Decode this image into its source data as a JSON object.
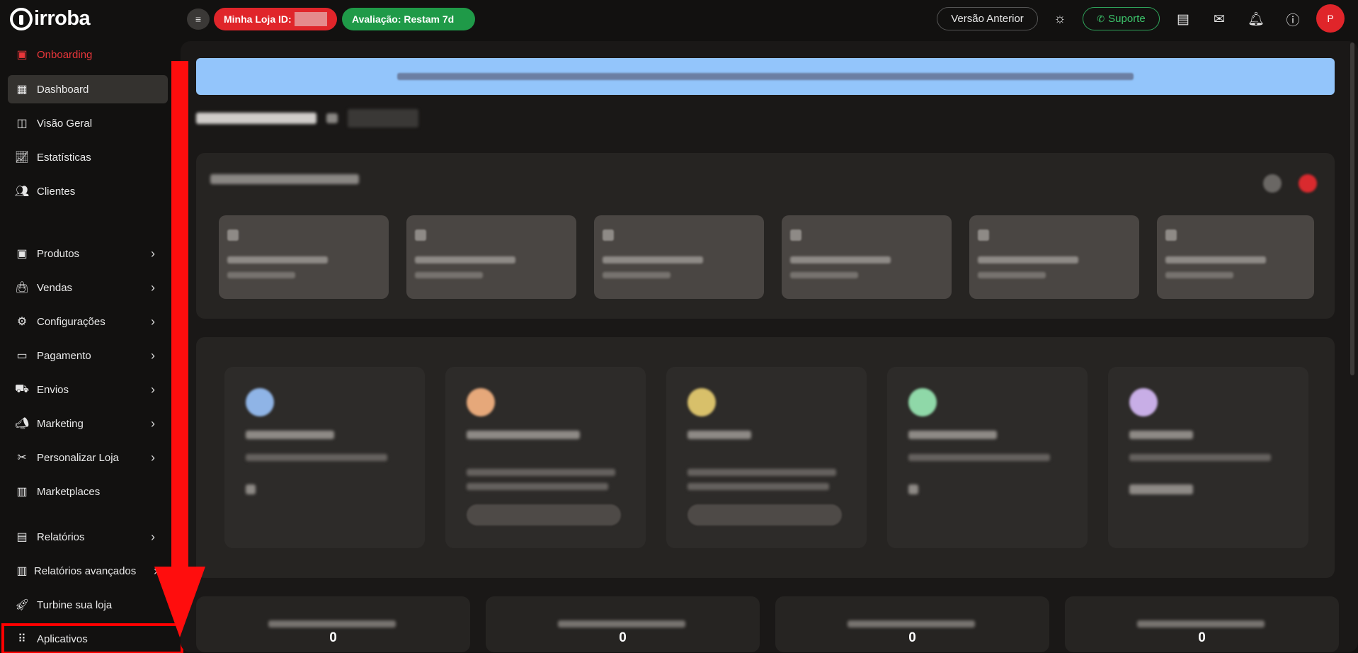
{
  "brand": {
    "logo_text": "irroba"
  },
  "topbar": {
    "store_label": "Minha Loja ID:",
    "trial_label": "Avaliação: Restam 7d",
    "version_label": "Versão Anterior",
    "support_label": "Suporte",
    "avatar_initial": "P",
    "icons": [
      "theme-toggle-icon",
      "layout-icon",
      "mail-icon",
      "bell-icon",
      "help-icon"
    ]
  },
  "sidebar": {
    "items": [
      {
        "label": "Onboarding",
        "icon": "onboarding-icon"
      },
      {
        "label": "Dashboard",
        "icon": "dashboard-icon"
      },
      {
        "label": "Visão Geral",
        "icon": "overview-icon"
      },
      {
        "label": "Estatísticas",
        "icon": "stats-icon"
      },
      {
        "label": "Clientes",
        "icon": "users-icon"
      },
      {
        "label": "Produtos",
        "icon": "box-icon"
      },
      {
        "label": "Vendas",
        "icon": "bag-icon"
      },
      {
        "label": "Configurações",
        "icon": "gear-icon"
      },
      {
        "label": "Pagamento",
        "icon": "card-icon"
      },
      {
        "label": "Envios",
        "icon": "truck-icon"
      },
      {
        "label": "Marketing",
        "icon": "megaphone-icon"
      },
      {
        "label": "Personalizar Loja",
        "icon": "tools-icon"
      },
      {
        "label": "Marketplaces",
        "icon": "store-icon"
      },
      {
        "label": "Relatórios",
        "icon": "report-icon"
      },
      {
        "label": "Relatórios avançados",
        "icon": "advanced-report-icon"
      },
      {
        "label": "Turbine sua loja",
        "icon": "rocket-icon"
      },
      {
        "label": "Aplicativos",
        "icon": "apps-icon"
      }
    ]
  },
  "bottom_stats": [
    {
      "value": "0"
    },
    {
      "value": "0"
    },
    {
      "value": "0"
    },
    {
      "value": "0"
    }
  ],
  "colors": {
    "brand_red": "#e0252a",
    "trial_green": "#1f9a48",
    "banner_blue": "#93c5fb",
    "annotation_red": "#ff0d0d"
  }
}
